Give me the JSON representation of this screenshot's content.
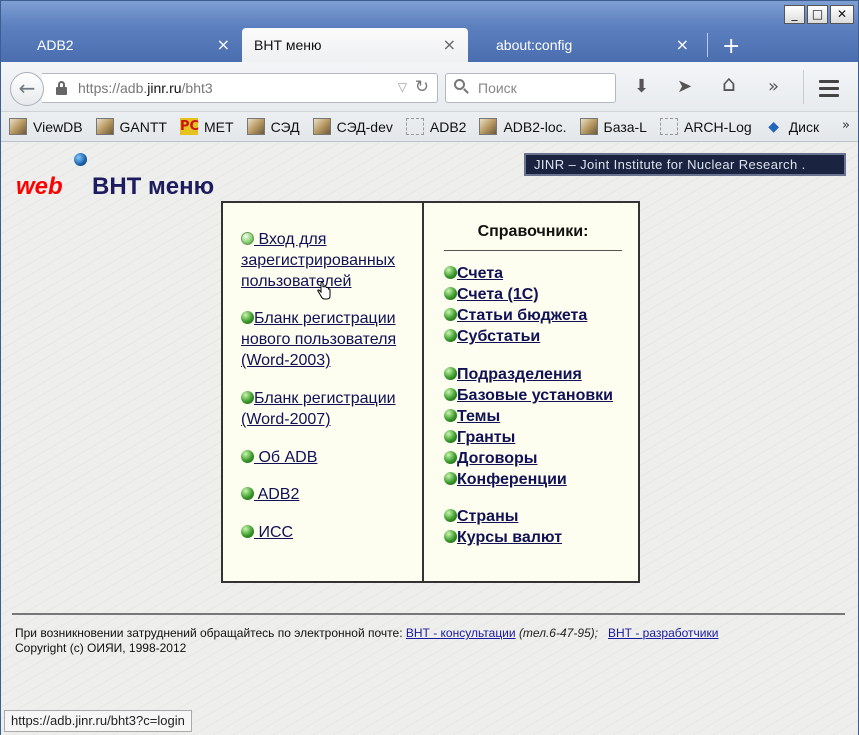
{
  "window": {
    "controls": {
      "minimize": "_",
      "maximize": "□",
      "close": "✕"
    }
  },
  "tabs": [
    {
      "label": "ADB2",
      "close": "×"
    },
    {
      "label": "ВНТ меню",
      "close": "×"
    },
    {
      "label": "about:config",
      "close": "×"
    }
  ],
  "new_tab": "+",
  "navbar": {
    "back": "←",
    "url_prefix": "https://adb.",
    "url_domain": "jinr.ru",
    "url_path": "/bht3",
    "url_dropdown": "▽",
    "reload": "↻",
    "search_placeholder": "Поиск",
    "download": "⬇",
    "send": "➤",
    "home": "⌂",
    "overflow": "»"
  },
  "bookmarks": [
    {
      "label": "ViewDB",
      "icon": "image-icon"
    },
    {
      "label": "GANTT",
      "icon": "image-icon"
    },
    {
      "label": "MET",
      "icon": "pc-icon"
    },
    {
      "label": "СЭД",
      "icon": "image-icon"
    },
    {
      "label": "СЭД-dev",
      "icon": "image-icon"
    },
    {
      "label": "ADB2",
      "icon": "folder-icon"
    },
    {
      "label": "ADB2-loc.",
      "icon": "image-icon"
    },
    {
      "label": "База-L",
      "icon": "image-icon"
    },
    {
      "label": "ARCH-Log",
      "icon": "folder-icon"
    },
    {
      "label": "Диск",
      "icon": "disk-icon"
    }
  ],
  "bookmarks_more": "»",
  "page": {
    "web": "web",
    "title": "ВНТ меню",
    "banner": "JINR – Joint Institute for Nuclear Research ."
  },
  "left_menu": [
    {
      "label": " Вход для зарегистрированных пользователей",
      "light": true
    },
    {
      "label": "Бланк регистрации нового пользователя (Word-2003)"
    },
    {
      "label": "Бланк регистрации (Word-2007)"
    },
    {
      "label": " Об ADB"
    },
    {
      "label": " ADB2"
    },
    {
      "label": " ИСС "
    }
  ],
  "right_menu": {
    "heading": "Справочники:",
    "items": [
      "Счета",
      "Счета (1С)",
      "Статьи бюджета",
      "Субстатьи",
      "Подразделения",
      "Базовые установки",
      "Темы",
      "Гранты",
      "Договоры",
      "Конференции",
      "Страны",
      "Курсы валют"
    ]
  },
  "footer": {
    "text1": "При возникновении затруднений обращайтесь по электронной почте: ",
    "link1": "ВНТ - консультации",
    "phone": "(тел.6-47-95);",
    "link2": "ВНТ - разработчики",
    "copyright": "Copyright (c) ОИЯИ, 1998-2012"
  },
  "status_url": "https://adb.jinr.ru/bht3?c=login"
}
